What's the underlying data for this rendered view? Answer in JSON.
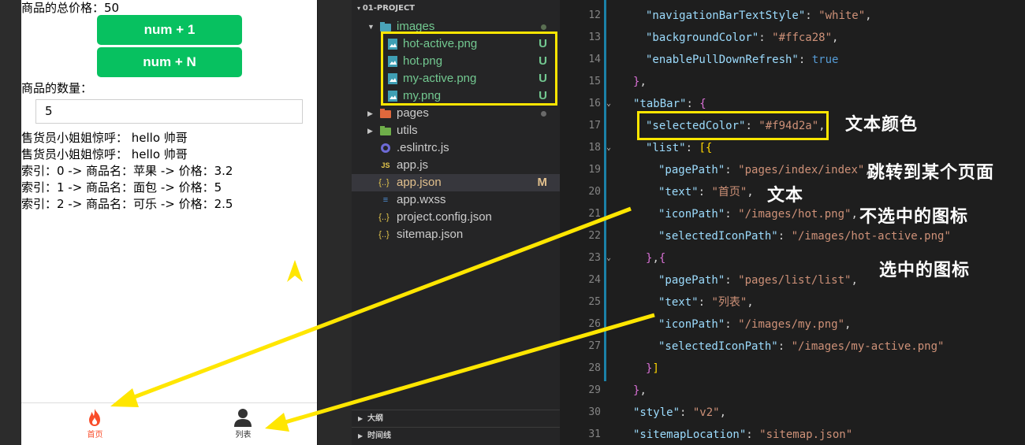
{
  "simulator": {
    "total_price": "商品的总价格：50",
    "btn_num_1": "num + 1",
    "btn_num_n": "num + N",
    "quantity_label": "商品的数量：",
    "quantity_value": "5",
    "greeting_1": "售货员小姐姐惊呼：  hello 帅哥",
    "greeting_2": "售货员小姐姐惊呼：  hello 帅哥",
    "items": [
      "索引：0 -> 商品名：苹果 -> 价格：3.2",
      "索引：1 -> 商品名：面包 -> 价格：5",
      "索引：2 -> 商品名：可乐 -> 价格：2.5"
    ],
    "tabs": [
      {
        "label": "首页",
        "icon": "fire-icon",
        "color": "#f94d2a"
      },
      {
        "label": "列表",
        "icon": "person-icon",
        "color": "#333333"
      }
    ]
  },
  "explorer": {
    "project": "01-PROJECT",
    "rows": [
      {
        "name": "images",
        "type": "folder",
        "open": true
      },
      {
        "name": "hot-active.png",
        "badge": "U"
      },
      {
        "name": "hot.png",
        "badge": "U"
      },
      {
        "name": "my-active.png",
        "badge": "U"
      },
      {
        "name": "my.png",
        "badge": "U"
      },
      {
        "name": "pages",
        "type": "folder"
      },
      {
        "name": "utils",
        "type": "folder"
      },
      {
        "name": ".eslintrc.js"
      },
      {
        "name": "app.js"
      },
      {
        "name": "app.json",
        "badge": "M"
      },
      {
        "name": "app.wxss"
      },
      {
        "name": "project.config.json"
      },
      {
        "name": "sitemap.json"
      }
    ],
    "outline": "大纲",
    "timeline": "时间线"
  },
  "editor": {
    "line_numbers": [
      "12",
      "13",
      "14",
      "15",
      "16",
      "17",
      "18",
      "19",
      "20",
      "21",
      "22",
      "23",
      "24",
      "25",
      "26",
      "27",
      "28",
      "29",
      "30",
      "31"
    ],
    "code": {
      "l12_key": "\"navigationBarTextStyle\"",
      "l12_val": "\"white\"",
      "l13_key": "\"backgroundColor\"",
      "l13_val": "\"#ffca28\"",
      "l14_key": "\"enablePullDownRefresh\"",
      "l14_val": "true",
      "l16_key": "\"tabBar\"",
      "l17_key": "\"selectedColor\"",
      "l17_val": "\"#f94d2a\"",
      "l18_key": "\"list\"",
      "l19_key": "\"pagePath\"",
      "l19_val": "\"pages/index/index\"",
      "l20_key": "\"text\"",
      "l20_val": "\"首页\"",
      "l21_key": "\"iconPath\"",
      "l21_val": "\"/images/hot.png\"",
      "l22_key": "\"selectedIconPath\"",
      "l22_val": "\"/images/hot-active.png\"",
      "l24_key": "\"pagePath\"",
      "l24_val": "\"pages/list/list\"",
      "l25_key": "\"text\"",
      "l25_val": "\"列表\"",
      "l26_key": "\"iconPath\"",
      "l26_val": "\"/images/my.png\"",
      "l27_key": "\"selectedIconPath\"",
      "l27_val": "\"/images/my-active.png\"",
      "l30_key": "\"style\"",
      "l30_val": "\"v2\"",
      "l31_key": "\"sitemapLocation\"",
      "l31_val": "\"sitemap.json\""
    }
  },
  "annotations": {
    "text_color": "文本颜色",
    "jump_page": "跳转到某个页面",
    "text": "文本",
    "unselected_icon": "不选中的图标",
    "selected_icon": "选中的图标"
  },
  "colors": {
    "highlight": "#ffe600",
    "selected": "#f94d2a",
    "button_green": "#07c160"
  }
}
